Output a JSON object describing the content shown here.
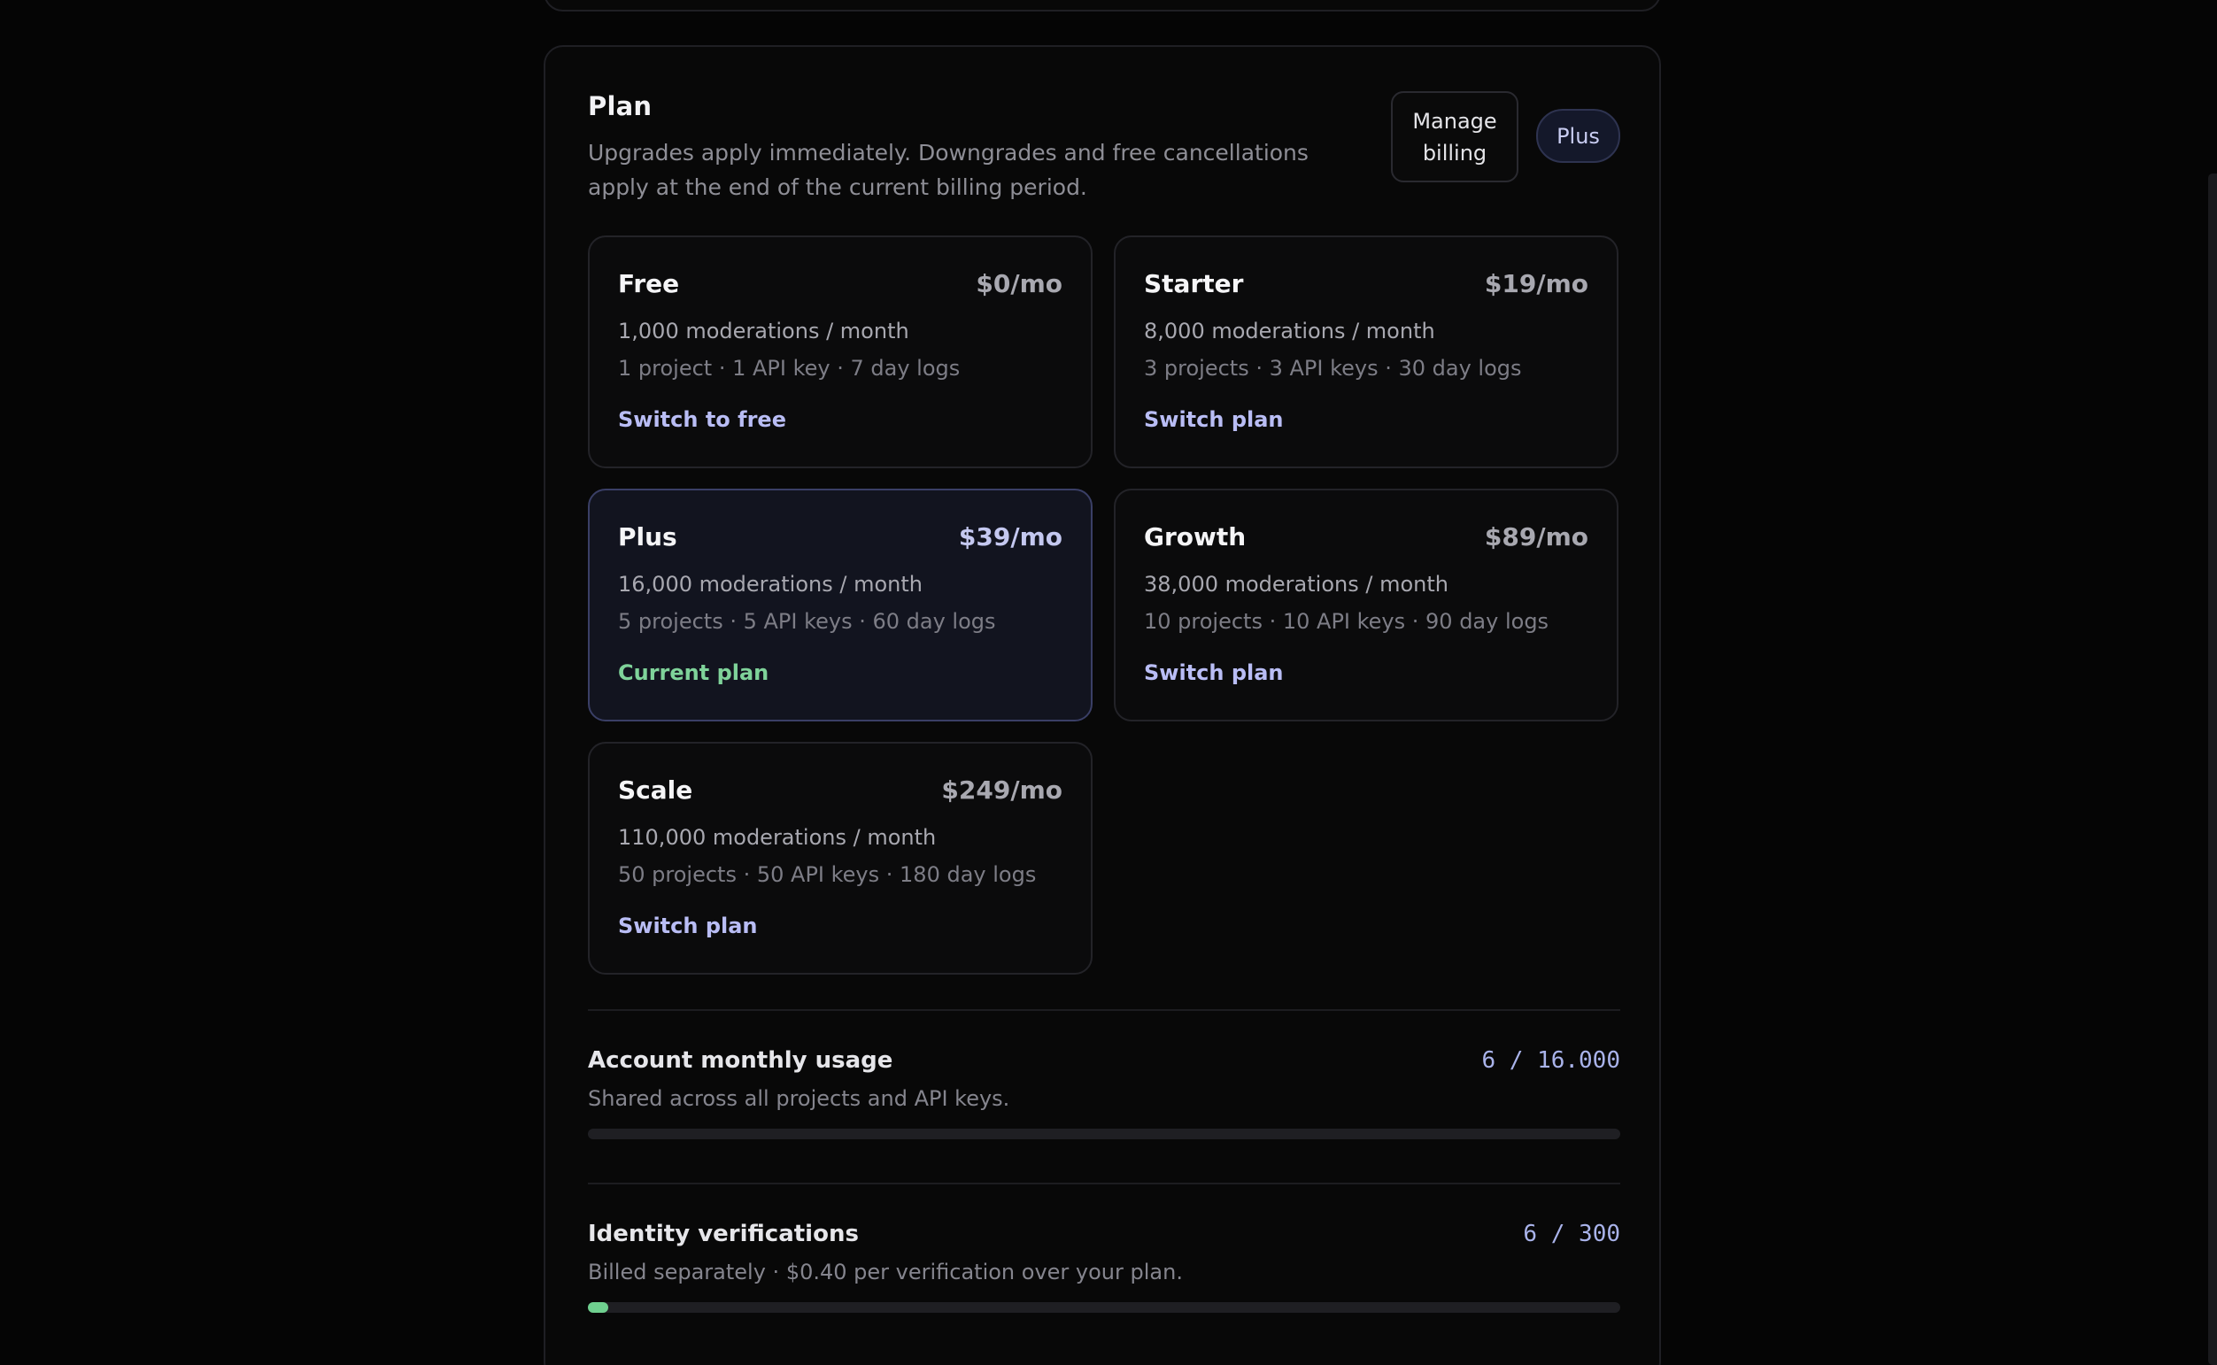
{
  "plan": {
    "title": "Plan",
    "description": "Upgrades apply immediately. Downgrades and free cancellations apply at the end of the current billing period.",
    "manage_billing_label": "Manage billing",
    "current_badge": "Plus"
  },
  "tiers": [
    {
      "name": "Free",
      "price": "$0/mo",
      "quota": "1,000 moderations / month",
      "limits": "1 project · 1 API key · 7 day logs",
      "action": "Switch to free",
      "current": false
    },
    {
      "name": "Starter",
      "price": "$19/mo",
      "quota": "8,000 moderations / month",
      "limits": "3 projects · 3 API keys · 30 day logs",
      "action": "Switch plan",
      "current": false
    },
    {
      "name": "Plus",
      "price": "$39/mo",
      "quota": "16,000 moderations / month",
      "limits": "5 projects · 5 API keys · 60 day logs",
      "action": "Current plan",
      "current": true
    },
    {
      "name": "Growth",
      "price": "$89/mo",
      "quota": "38,000 moderations / month",
      "limits": "10 projects · 10 API keys · 90 day logs",
      "action": "Switch plan",
      "current": false
    },
    {
      "name": "Scale",
      "price": "$249/mo",
      "quota": "110,000 moderations / month",
      "limits": "50 projects · 50 API keys · 180 day logs",
      "action": "Switch plan",
      "current": false
    }
  ],
  "usage": {
    "monthly": {
      "title": "Account monthly usage",
      "subtitle": "Shared across all projects and API keys.",
      "count": "6 / 16.000",
      "fraction": 0.000375
    },
    "identity": {
      "title": "Identity verifications",
      "subtitle": "Billed separately · $0.40 per verification over your plan.",
      "count": "6 / 300",
      "fraction": 0.02
    }
  },
  "colors": {
    "accent": "#b9bdf5",
    "success": "#7fd39a",
    "background": "#050505"
  }
}
